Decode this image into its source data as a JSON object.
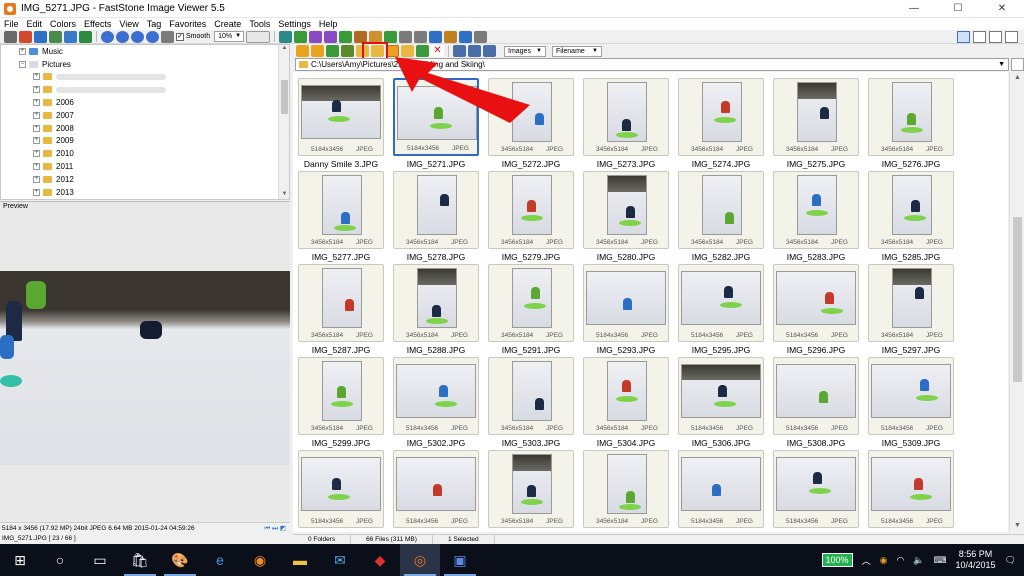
{
  "window": {
    "title": "IMG_5271.JPG - FastStone Image Viewer 5.5",
    "min": "—",
    "max": "☐",
    "close": "✕"
  },
  "menu": [
    "File",
    "Edit",
    "Colors",
    "Effects",
    "View",
    "Tag",
    "Favorites",
    "Create",
    "Tools",
    "Settings",
    "Help"
  ],
  "toolbar": {
    "smooth_label": "Smooth",
    "smooth_checked": "✓",
    "zoom_value": "10%",
    "sort_filter": "Images",
    "sort_by": "Filename"
  },
  "tree": {
    "items": [
      {
        "label": "Music",
        "expander": "+"
      },
      {
        "label": "Pictures",
        "expander": "−"
      },
      {
        "label": "",
        "expander": "+"
      },
      {
        "label": "",
        "expander": "+"
      },
      {
        "label": "2006",
        "expander": "+"
      },
      {
        "label": "2007",
        "expander": "+"
      },
      {
        "label": "2008",
        "expander": "+"
      },
      {
        "label": "2009",
        "expander": "+"
      },
      {
        "label": "2010",
        "expander": "+"
      },
      {
        "label": "2011",
        "expander": "+"
      },
      {
        "label": "2012",
        "expander": "+"
      },
      {
        "label": "2013",
        "expander": "+"
      }
    ]
  },
  "preview": {
    "header": "Preview",
    "info": "5184 x 3456 (17.92 MP)  24bit  JPEG  6.64 MB  2015-01-24 04:59:26",
    "file_position": "IMG_5271.JPG [ 23 / 66 ]"
  },
  "address": {
    "path": "C:\\Users\\Amy\\Pictures\\2...  ...h Riding and Skiing\\"
  },
  "thumbnails": [
    {
      "name": "Danny Smile 3.JPG",
      "dims": "5184x3456",
      "fmt": "JPEG",
      "orient": "land"
    },
    {
      "name": "IMG_5271.JPG",
      "dims": "5184x3456",
      "fmt": "JPEG",
      "orient": "land",
      "selected": true
    },
    {
      "name": "IMG_5272.JPG",
      "dims": "3456x5184",
      "fmt": "JPEG",
      "orient": "port"
    },
    {
      "name": "IMG_5273.JPG",
      "dims": "3456x5184",
      "fmt": "JPEG",
      "orient": "port"
    },
    {
      "name": "IMG_5274.JPG",
      "dims": "3456x5184",
      "fmt": "JPEG",
      "orient": "port"
    },
    {
      "name": "IMG_5275.JPG",
      "dims": "3456x5184",
      "fmt": "JPEG",
      "orient": "port"
    },
    {
      "name": "IMG_5276.JPG",
      "dims": "3456x5184",
      "fmt": "JPEG",
      "orient": "port"
    },
    {
      "name": "IMG_5277.JPG",
      "dims": "3456x5184",
      "fmt": "JPEG",
      "orient": "port"
    },
    {
      "name": "IMG_5278.JPG",
      "dims": "3456x5184",
      "fmt": "JPEG",
      "orient": "port"
    },
    {
      "name": "IMG_5279.JPG",
      "dims": "3456x5184",
      "fmt": "JPEG",
      "orient": "port"
    },
    {
      "name": "IMG_5280.JPG",
      "dims": "3456x5184",
      "fmt": "JPEG",
      "orient": "port"
    },
    {
      "name": "IMG_5282.JPG",
      "dims": "3456x5184",
      "fmt": "JPEG",
      "orient": "port"
    },
    {
      "name": "IMG_5283.JPG",
      "dims": "3456x5184",
      "fmt": "JPEG",
      "orient": "port"
    },
    {
      "name": "IMG_5285.JPG",
      "dims": "3456x5184",
      "fmt": "JPEG",
      "orient": "port"
    },
    {
      "name": "IMG_5287.JPG",
      "dims": "3456x5184",
      "fmt": "JPEG",
      "orient": "port"
    },
    {
      "name": "IMG_5288.JPG",
      "dims": "3456x5184",
      "fmt": "JPEG",
      "orient": "port"
    },
    {
      "name": "IMG_5291.JPG",
      "dims": "3456x5184",
      "fmt": "JPEG",
      "orient": "port"
    },
    {
      "name": "IMG_5293.JPG",
      "dims": "5184x3456",
      "fmt": "JPEG",
      "orient": "land"
    },
    {
      "name": "IMG_5295.JPG",
      "dims": "5184x3456",
      "fmt": "JPEG",
      "orient": "land"
    },
    {
      "name": "IMG_5296.JPG",
      "dims": "5184x3456",
      "fmt": "JPEG",
      "orient": "land"
    },
    {
      "name": "IMG_5297.JPG",
      "dims": "3456x5184",
      "fmt": "JPEG",
      "orient": "port"
    },
    {
      "name": "IMG_5299.JPG",
      "dims": "3456x5184",
      "fmt": "JPEG",
      "orient": "port"
    },
    {
      "name": "IMG_5302.JPG",
      "dims": "5184x3456",
      "fmt": "JPEG",
      "orient": "land"
    },
    {
      "name": "IMG_5303.JPG",
      "dims": "3456x5184",
      "fmt": "JPEG",
      "orient": "port"
    },
    {
      "name": "IMG_5304.JPG",
      "dims": "3456x5184",
      "fmt": "JPEG",
      "orient": "port"
    },
    {
      "name": "IMG_5306.JPG",
      "dims": "5184x3456",
      "fmt": "JPEG",
      "orient": "land"
    },
    {
      "name": "IMG_5308.JPG",
      "dims": "5184x3456",
      "fmt": "JPEG",
      "orient": "land"
    },
    {
      "name": "IMG_5309.JPG",
      "dims": "5184x3456",
      "fmt": "JPEG",
      "orient": "land"
    },
    {
      "name": "",
      "dims": "5184x3456",
      "fmt": "JPEG",
      "orient": "land"
    },
    {
      "name": "",
      "dims": "5184x3456",
      "fmt": "JPEG",
      "orient": "land"
    },
    {
      "name": "",
      "dims": "3456x5184",
      "fmt": "JPEG",
      "orient": "port"
    },
    {
      "name": "",
      "dims": "3456x5184",
      "fmt": "JPEG",
      "orient": "port"
    },
    {
      "name": "",
      "dims": "5184x3456",
      "fmt": "JPEG",
      "orient": "land"
    },
    {
      "name": "",
      "dims": "5184x3456",
      "fmt": "JPEG",
      "orient": "land"
    },
    {
      "name": "",
      "dims": "5184x3456",
      "fmt": "JPEG",
      "orient": "land"
    }
  ],
  "status": {
    "folders": "0 Folders",
    "files": "66 Files (311 MB)",
    "selected": "1 Selected"
  },
  "taskbar": {
    "battery": "100%",
    "time": "8:56 PM",
    "date": "10/4/2015"
  },
  "colors": {
    "highlight": "#e01010",
    "selection": "#3269c7",
    "accent": "#e87a1e"
  }
}
